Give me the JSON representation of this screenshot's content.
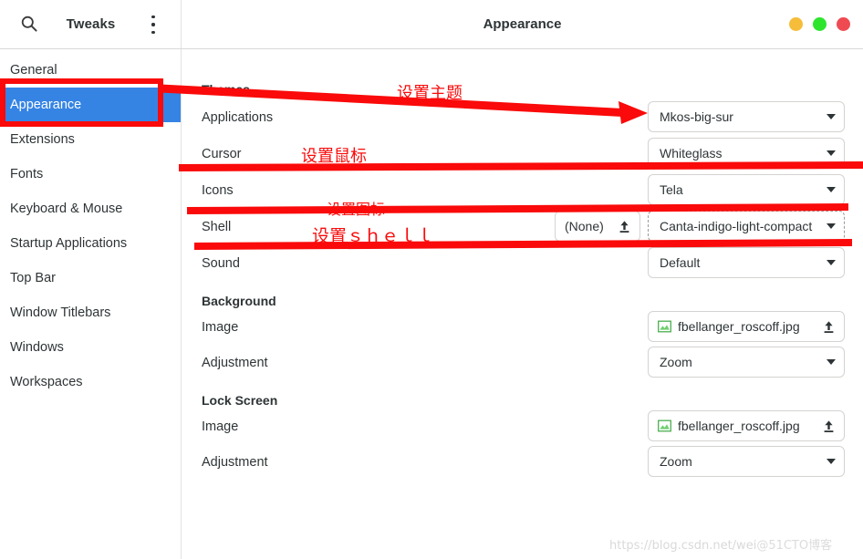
{
  "window": {
    "left_title": "Tweaks",
    "main_title": "Appearance",
    "controls": [
      {
        "name": "minimize",
        "color": "#f6bd3a"
      },
      {
        "name": "maximize",
        "color": "#2ee52e"
      },
      {
        "name": "close",
        "color": "#ef4a52"
      }
    ]
  },
  "sidebar": {
    "items": [
      {
        "label": "General",
        "selected": false
      },
      {
        "label": "Appearance",
        "selected": true
      },
      {
        "label": "Extensions",
        "selected": false
      },
      {
        "label": "Fonts",
        "selected": false
      },
      {
        "label": "Keyboard & Mouse",
        "selected": false
      },
      {
        "label": "Startup Applications",
        "selected": false
      },
      {
        "label": "Top Bar",
        "selected": false
      },
      {
        "label": "Window Titlebars",
        "selected": false
      },
      {
        "label": "Windows",
        "selected": false
      },
      {
        "label": "Workspaces",
        "selected": false
      }
    ]
  },
  "sections": {
    "themes": {
      "heading": "Themes",
      "rows": {
        "applications": {
          "label": "Applications",
          "value": "Mkos-big-sur"
        },
        "cursor": {
          "label": "Cursor",
          "value": "Whiteglass"
        },
        "icons": {
          "label": "Icons",
          "value": "Tela"
        },
        "shell": {
          "label": "Shell",
          "value": "Canta-indigo-light-compact",
          "file_value": "(None)"
        },
        "sound": {
          "label": "Sound",
          "value": "Default"
        }
      }
    },
    "background": {
      "heading": "Background",
      "rows": {
        "image": {
          "label": "Image",
          "value": "fbellanger_roscoff.jpg"
        },
        "adjustment": {
          "label": "Adjustment",
          "value": "Zoom"
        }
      }
    },
    "lock_screen": {
      "heading": "Lock Screen",
      "rows": {
        "image": {
          "label": "Image",
          "value": "fbellanger_roscoff.jpg"
        },
        "adjustment": {
          "label": "Adjustment",
          "value": "Zoom"
        }
      }
    }
  },
  "annotations": {
    "color": "#fa0a0a",
    "notes": [
      {
        "id": "theme",
        "text": "设置主题"
      },
      {
        "id": "cursor",
        "text": "设置鼠标"
      },
      {
        "id": "icons",
        "text": "设置图标"
      },
      {
        "id": "shell",
        "text": "设置ｓｈｅｌｌ"
      }
    ]
  },
  "watermark": {
    "url": "https://blog.csdn.net/wei",
    "tag": "@51CTO博客"
  },
  "colors": {
    "selection": "#3584e4",
    "annotation": "#fa0a0a",
    "text": "#2e3436"
  }
}
